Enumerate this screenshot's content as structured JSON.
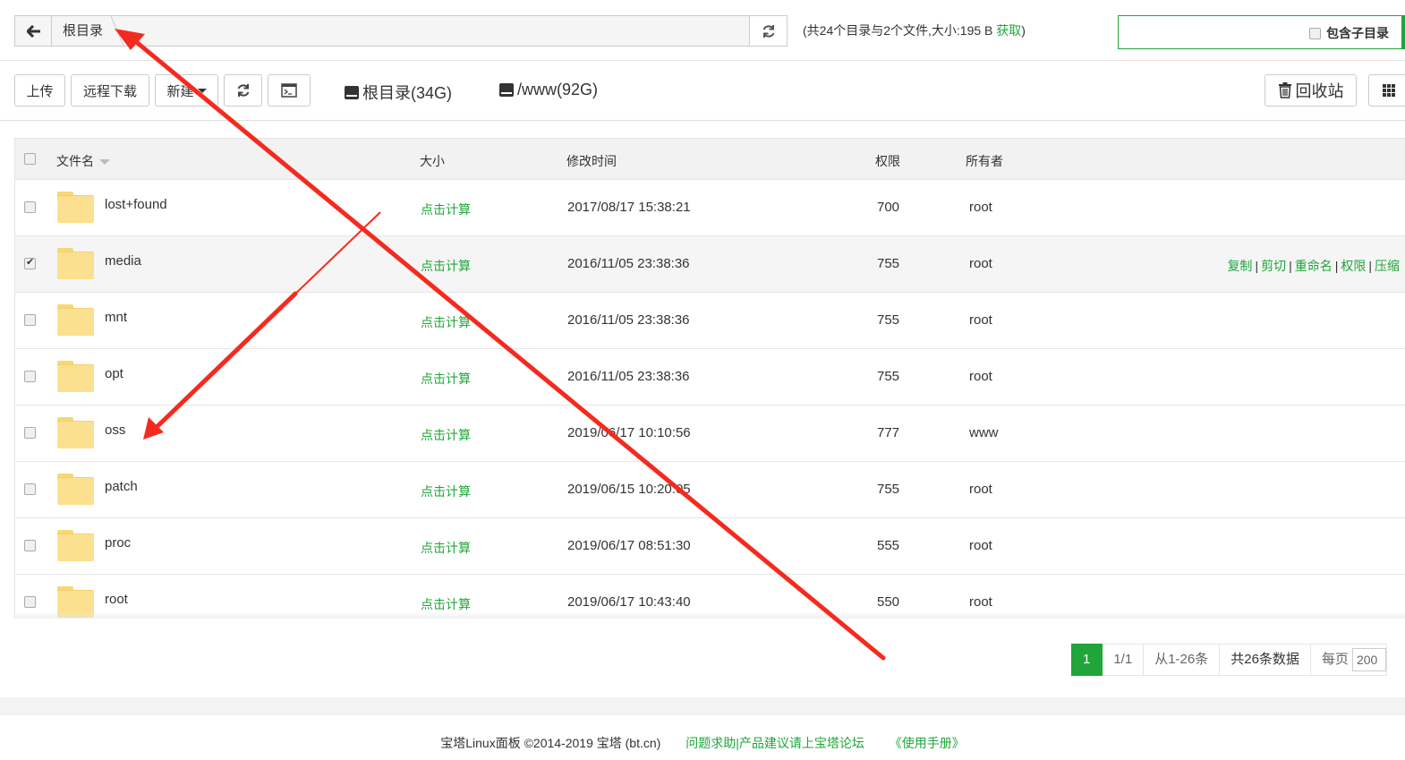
{
  "pathbar": {
    "root_label": "根目录",
    "summary_prefix": "(共24个目录与2个文件,大小:195 B ",
    "summary_get": "获取",
    "summary_suffix": ")",
    "include_subdir_label": "包含子目录"
  },
  "toolbar": {
    "upload_label": "上传",
    "remote_download_label": "远程下载",
    "new_label": "新建",
    "disk_root_label": "根目录(34G)",
    "disk_www_label": "/www(92G)",
    "recycle_label": "回收站"
  },
  "table": {
    "headers": {
      "name": "文件名",
      "size": "大小",
      "mtime": "修改时间",
      "perm": "权限",
      "owner": "所有者"
    },
    "rows": [
      {
        "name": "lost+found",
        "size": "点击计算",
        "mtime": "2017/08/17 15:38:21",
        "perm": "700",
        "owner": "root"
      },
      {
        "name": "media",
        "size": "点击计算",
        "mtime": "2016/11/05 23:38:36",
        "perm": "755",
        "owner": "root"
      },
      {
        "name": "mnt",
        "size": "点击计算",
        "mtime": "2016/11/05 23:38:36",
        "perm": "755",
        "owner": "root"
      },
      {
        "name": "opt",
        "size": "点击计算",
        "mtime": "2016/11/05 23:38:36",
        "perm": "755",
        "owner": "root"
      },
      {
        "name": "oss",
        "size": "点击计算",
        "mtime": "2019/06/17 10:10:56",
        "perm": "777",
        "owner": "www"
      },
      {
        "name": "patch",
        "size": "点击计算",
        "mtime": "2019/06/15 10:20:05",
        "perm": "755",
        "owner": "root"
      },
      {
        "name": "proc",
        "size": "点击计算",
        "mtime": "2019/06/17 08:51:30",
        "perm": "555",
        "owner": "root"
      },
      {
        "name": "root",
        "size": "点击计算",
        "mtime": "2019/06/17 10:43:40",
        "perm": "550",
        "owner": "root"
      }
    ],
    "row_actions": {
      "copy": "复制",
      "cut": "剪切",
      "rename": "重命名",
      "perm": "权限",
      "compress": "压缩"
    }
  },
  "pagination": {
    "current_page": "1",
    "page_of": "1/1",
    "range": "从1-26条",
    "total": "共26条数据",
    "per_page_label": "每页",
    "per_page_value": "200"
  },
  "footer": {
    "copyright": "宝塔Linux面板 ©2014-2019 宝塔 (bt.cn)",
    "forum_link": "问题求助|产品建议请上宝塔论坛",
    "manual_link": "《使用手册》"
  },
  "colors": {
    "accent": "#20a53a",
    "annotation": "#f52a1f"
  }
}
